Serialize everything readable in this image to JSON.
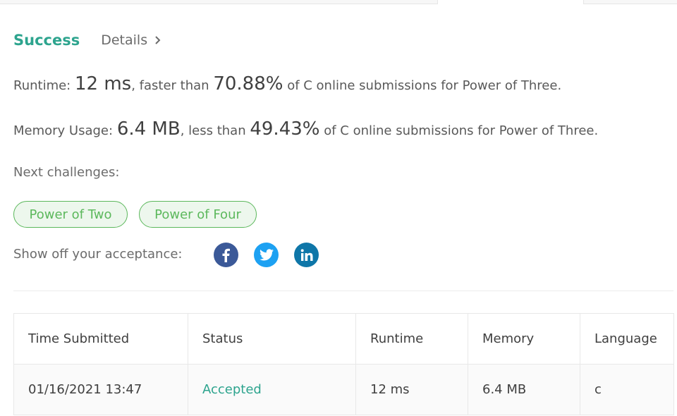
{
  "header": {
    "status": "Success",
    "details_label": "Details"
  },
  "runtime": {
    "label": "Runtime:",
    "value": "12 ms",
    "comparison": ", faster than",
    "percent": "70.88%",
    "suffix": "of C online submissions for Power of Three."
  },
  "memory": {
    "label": "Memory Usage:",
    "value": "6.4 MB",
    "comparison": ", less than",
    "percent": "49.43%",
    "suffix": "of C online submissions for Power of Three."
  },
  "next": {
    "label": "Next challenges:",
    "challenges": [
      "Power of Two",
      "Power of Four"
    ]
  },
  "share": {
    "label": "Show off your acceptance:",
    "icons": [
      "facebook-icon",
      "twitter-icon",
      "linkedin-icon"
    ]
  },
  "table": {
    "headers": [
      "Time Submitted",
      "Status",
      "Runtime",
      "Memory",
      "Language"
    ],
    "rows": [
      [
        "01/16/2021 13:47",
        "Accepted",
        "12 ms",
        "6.4 MB",
        "c"
      ]
    ]
  },
  "colors": {
    "success": "#2da48e",
    "chip": "#5cb85c",
    "facebook": "#3b5998",
    "twitter": "#1da1f2",
    "linkedin": "#0e76a8"
  }
}
